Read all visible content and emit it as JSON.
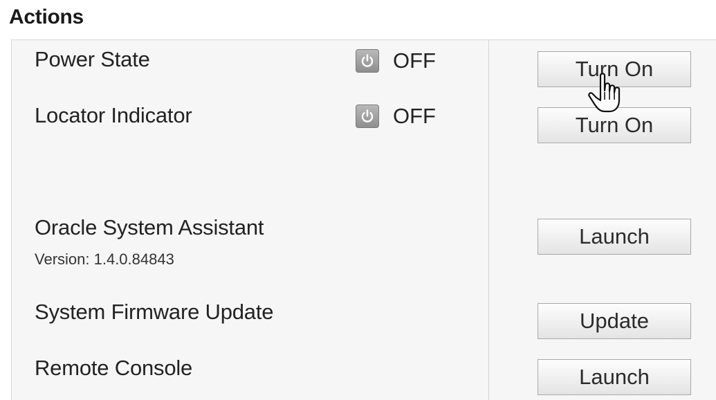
{
  "section_title": "Actions",
  "rows": [
    {
      "label": "Power State",
      "state": "OFF",
      "state_icon": "power-icon",
      "button": "Turn On"
    },
    {
      "label": "Locator Indicator",
      "state": "OFF",
      "state_icon": "power-icon",
      "button": "Turn On"
    },
    {
      "label": "Oracle System Assistant",
      "sublabel": "Version: 1.4.0.84843",
      "button": "Launch"
    },
    {
      "label": "System Firmware Update",
      "button": "Update"
    },
    {
      "label": "Remote Console",
      "button": "Launch"
    }
  ],
  "cursor": "hand-pointer-icon"
}
